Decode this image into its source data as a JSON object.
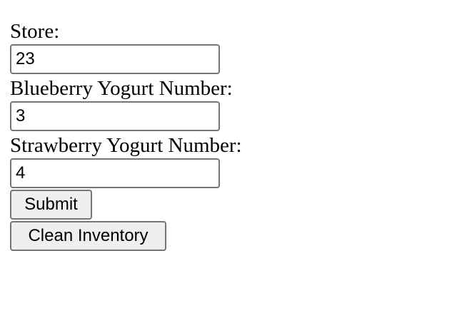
{
  "form": {
    "store": {
      "label": "Store:",
      "value": "23"
    },
    "blueberry": {
      "label": "Blueberry Yogurt Number:",
      "value": "3"
    },
    "strawberry": {
      "label": "Strawberry Yogurt Number:",
      "value": "4"
    },
    "submit_label": "Submit",
    "clean_label": "Clean Inventory"
  }
}
